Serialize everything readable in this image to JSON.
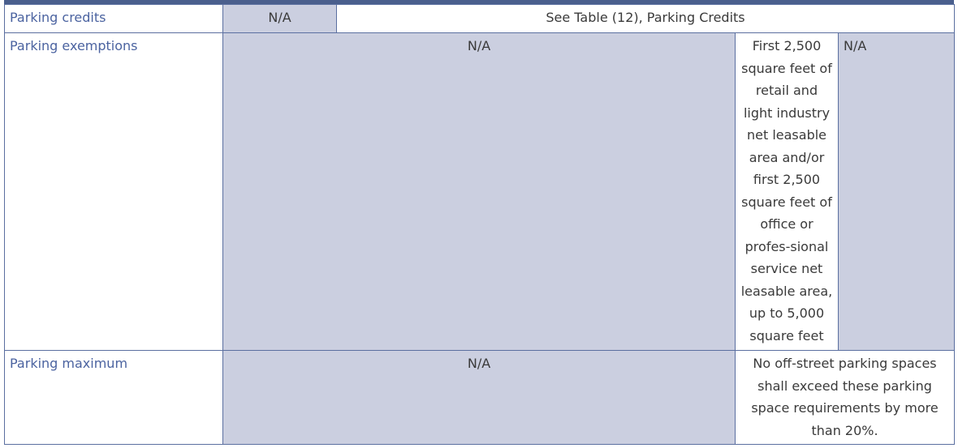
{
  "table": {
    "rows": [
      {
        "label": "Parking credits",
        "cells": [
          "N/A",
          "See Table (12), Parking Credits"
        ]
      },
      {
        "label": "Parking exemptions",
        "cells": [
          "N/A",
          "First 2,500 square feet of retail and light industry net leasable area and/or first 2,500 square feet of office or profes-sional service net leasable area, up to 5,000 square feet",
          "N/A"
        ]
      },
      {
        "label": "Parking maximum",
        "cells": [
          "N/A",
          "No off-street parking spaces shall exceed these parking space requirements by more than 20%."
        ]
      }
    ]
  },
  "colors": {
    "rule": "#4a5f8d",
    "border": "#5b6fa0",
    "shade": "#cbcfe0",
    "label_text": "#4b63a0"
  }
}
